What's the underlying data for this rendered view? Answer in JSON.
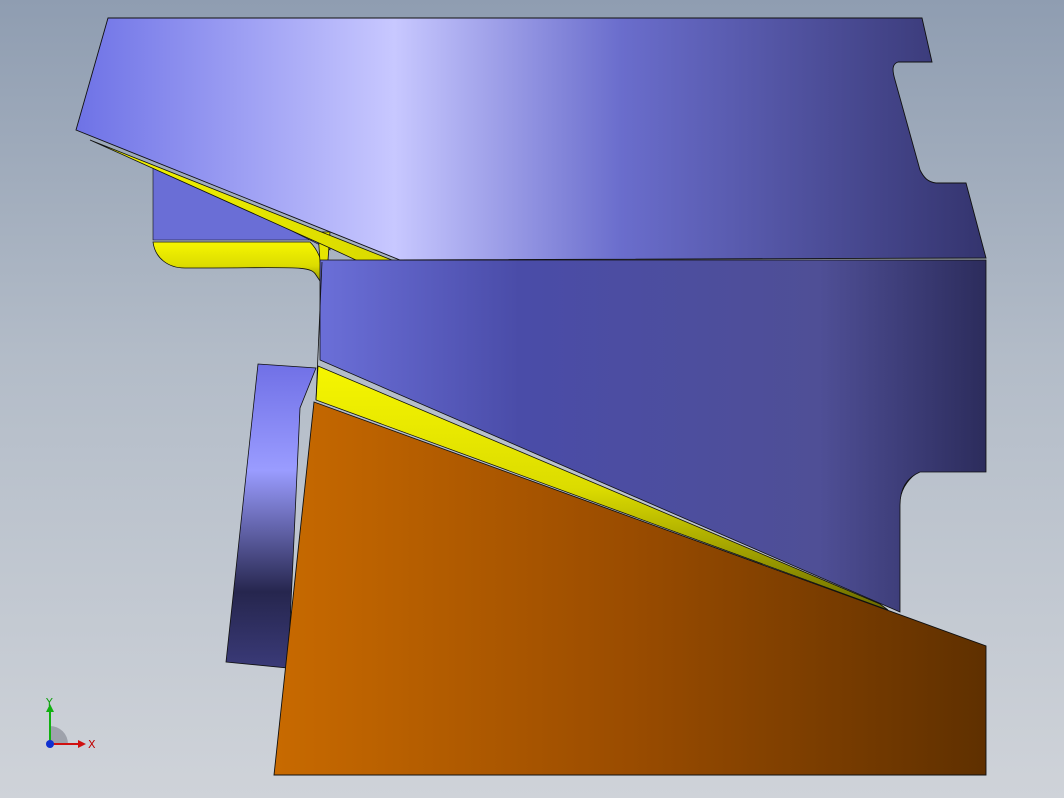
{
  "view": {
    "background_top": "#8f9db1",
    "background_bottom": "#cfd3d9"
  },
  "model": {
    "face_colors": {
      "blue_light": "#c9c9ff",
      "blue_mid": "#7a7ef0",
      "blue_dark": "#303067",
      "fillet_yellow": "#f0f000",
      "fillet_shadow": "#5a5a00",
      "orange_light": "#c86a00",
      "orange_dark": "#5f3000",
      "edge": "#101010"
    }
  },
  "triad": {
    "x_label": "X",
    "y_label": "Y",
    "x_color": "#d01010",
    "y_color": "#10b010",
    "z_color": "#1030d0"
  }
}
